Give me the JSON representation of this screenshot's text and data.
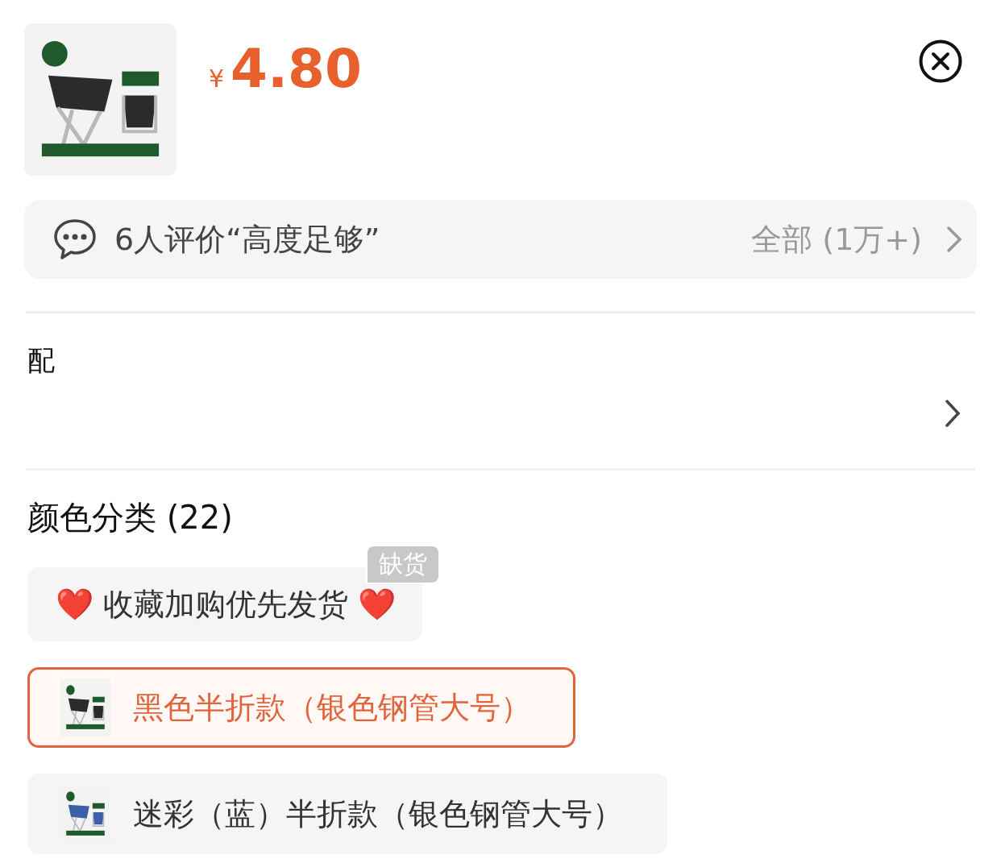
{
  "product": {
    "currency": "¥",
    "price": "4.80"
  },
  "reviews": {
    "summary": "6人评价“高度足够”",
    "all_link": "全部 (1万+)"
  },
  "delivery": {
    "label": "配"
  },
  "sku": {
    "title": "颜色分类 (22)",
    "options": [
      {
        "kind": "text",
        "label": "❤️ 收藏加购优先发货 ❤️",
        "badge": "缺货",
        "selected": false
      },
      {
        "kind": "thumb",
        "label": "黑色半折款（银色钢管大号）",
        "selected": true
      },
      {
        "kind": "thumb",
        "label": "迷彩（蓝）半折款（银色钢管大号）",
        "selected": false
      }
    ]
  }
}
